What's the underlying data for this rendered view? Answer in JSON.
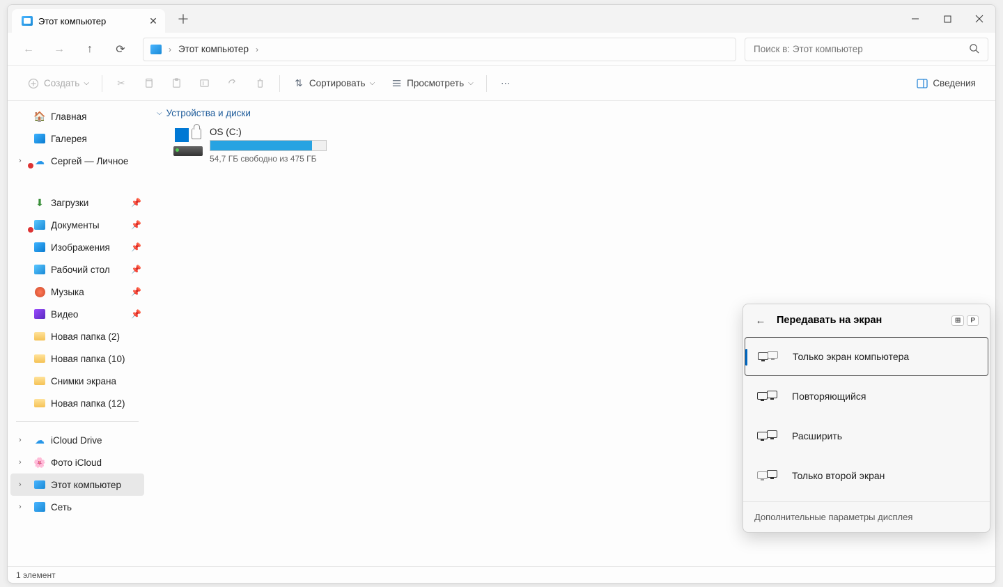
{
  "tab": {
    "title": "Этот компьютер"
  },
  "breadcrumb": {
    "location": "Этот компьютер"
  },
  "search": {
    "placeholder": "Поиск в: Этот компьютер"
  },
  "cmd": {
    "new": "Создать",
    "sort": "Сортировать",
    "view": "Просмотреть",
    "details": "Сведения"
  },
  "sidebar": {
    "home": "Главная",
    "gallery": "Галерея",
    "onedrive": "Сергей — Личное",
    "downloads": "Загрузки",
    "documents": "Документы",
    "pictures": "Изображения",
    "desktop": "Рабочий стол",
    "music": "Музыка",
    "videos": "Видео",
    "nf2": "Новая папка (2)",
    "nf10": "Новая папка (10)",
    "screenshots": "Снимки экрана",
    "nf12": "Новая папка (12)",
    "icloud": "iCloud Drive",
    "icloud_photos": "Фото iCloud",
    "this_pc": "Этот компьютер",
    "network": "Сеть"
  },
  "main": {
    "group": "Устройства и диски",
    "drive_name": "OS (C:)",
    "drive_sub": "54,7 ГБ свободно из 475 ГБ",
    "drive_fill_pct": 88
  },
  "status": {
    "text": "1 элемент"
  },
  "flyout": {
    "title": "Передавать на экран",
    "key2": "P",
    "opt_pc_only": "Только экран компьютера",
    "opt_dup": "Повторяющийся",
    "opt_ext": "Расширить",
    "opt_second": "Только второй экран",
    "footer": "Дополнительные параметры дисплея"
  }
}
